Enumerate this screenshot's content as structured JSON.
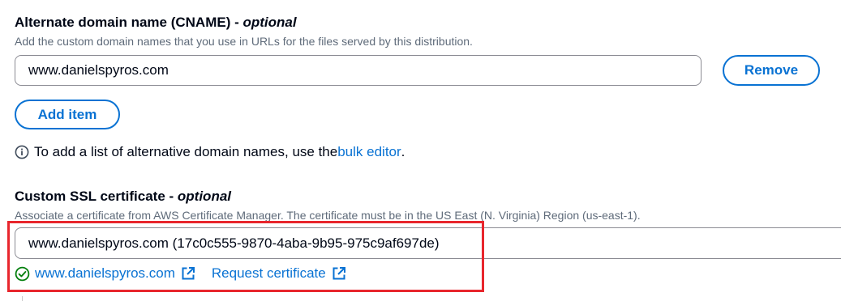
{
  "cname": {
    "title": "Alternate domain name (CNAME)",
    "optional": "optional",
    "description": "Add the custom domain names that you use in URLs for the files served by this distribution.",
    "input_value": "www.danielspyros.com",
    "remove_label": "Remove",
    "add_item_label": "Add item",
    "info_prefix": "To add a list of alternative domain names, use the ",
    "info_link": "bulk editor",
    "info_suffix": "."
  },
  "ssl": {
    "title": "Custom SSL certificate",
    "optional": "optional",
    "description": "Associate a certificate from AWS Certificate Manager. The certificate must be in the US East (N. Virginia) Region (us-east-1).",
    "selected_value": "www.danielspyros.com (17c0c555-9870-4aba-9b95-975c9af697de)",
    "cert_link": "www.danielspyros.com",
    "request_link": "Request certificate"
  },
  "colors": {
    "link": "#0972d3",
    "success": "#037f0c",
    "highlight": "#e8262d"
  },
  "icons": {
    "info": "info-circle-icon",
    "success": "check-circle-icon",
    "external": "external-link-icon"
  }
}
